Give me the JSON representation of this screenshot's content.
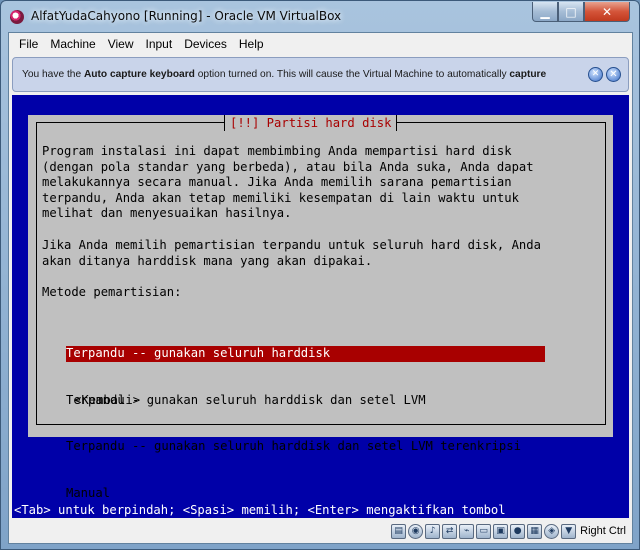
{
  "window": {
    "title": "AlfatYudaCahyono [Running] - Oracle VM VirtualBox",
    "minimize_glyph": "▁",
    "maximize_glyph": "□",
    "close_glyph": "✕"
  },
  "menu": [
    "File",
    "Machine",
    "View",
    "Input",
    "Devices",
    "Help"
  ],
  "notification": {
    "text_before": "You have the ",
    "bold1": "Auto capture keyboard",
    "text_middle": " option turned on. This will cause the Virtual Machine to automatically ",
    "bold2": "capture"
  },
  "installer": {
    "dialog_title": "[!!] Partisi hard disk",
    "intro_paragraph": "Program instalasi ini dapat membimbing Anda mempartisi hard disk\n(dengan pola standar yang berbeda), atau bila Anda suka, Anda dapat\nmelakukannya secara manual. Jika Anda memilih sarana pemartisian\nterpandu, Anda akan tetap memiliki kesempatan di lain waktu untuk\nmelihat dan menyesuaikan hasilnya.",
    "second_paragraph": "Jika Anda memilih pemartisian terpandu untuk seluruh hard disk, Anda\nakan ditanya harddisk mana yang akan dipakai.",
    "method_label": "Metode pemartisian:",
    "options": [
      "Terpandu -- gunakan seluruh harddisk",
      "Terpandu - gunakan seluruh harddisk dan setel LVM",
      "Terpandu -- gunakan seluruh harddisk dan setel LVM terenkripsi",
      "Manual"
    ],
    "selected_option_index": 0,
    "back_button": "<Kembali>",
    "key_hint": "<Tab> untuk berpindah; <Spasi> memilih; <Enter> mengaktifkan tombol"
  },
  "statusbar": {
    "icons": [
      "hard-disk-icon",
      "optical-disk-icon",
      "audio-icon",
      "network-icon",
      "usb-icon",
      "shared-folder-icon",
      "display-icon",
      "video-capture-icon",
      "virtualization-icon",
      "mouse-integration-icon",
      "host-key-arrow-icon"
    ],
    "host_key": "Right Ctrl"
  },
  "colors": {
    "vm_background": "#0000a8",
    "dialog_background": "#c0c0c0",
    "title_red": "#a80000",
    "selection": "#a80000"
  }
}
